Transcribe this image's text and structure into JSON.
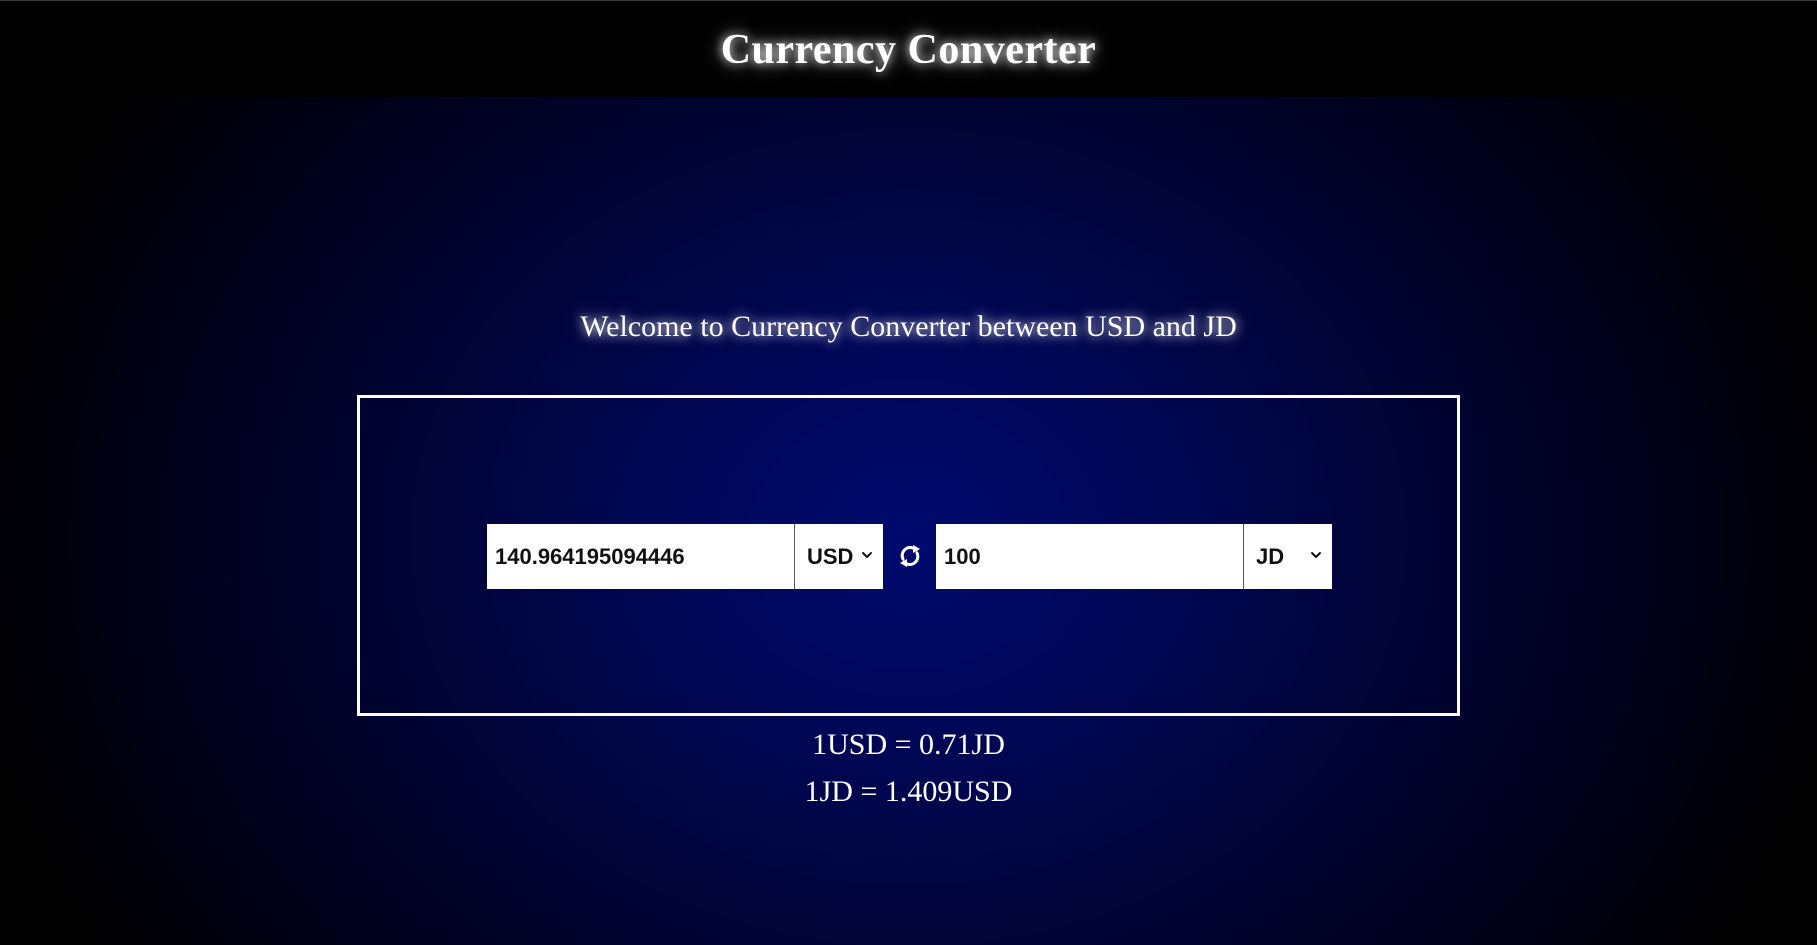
{
  "header": {
    "title": "Currency Converter"
  },
  "main": {
    "welcome": "Welcome to Currency Converter between USD and JD",
    "from": {
      "amount": "140.964195094446",
      "currency": "USD"
    },
    "swap_icon": "swap-arrows-icon",
    "to": {
      "amount": "100",
      "currency": "JD"
    },
    "rates": {
      "usd_to_jd": "1USD = 0.71JD",
      "jd_to_usd": "1JD = 1.409USD"
    }
  },
  "colors": {
    "background": "#000000",
    "gradient_center": "#000a6e",
    "text": "#ffffff",
    "box_border": "#ffffff"
  }
}
